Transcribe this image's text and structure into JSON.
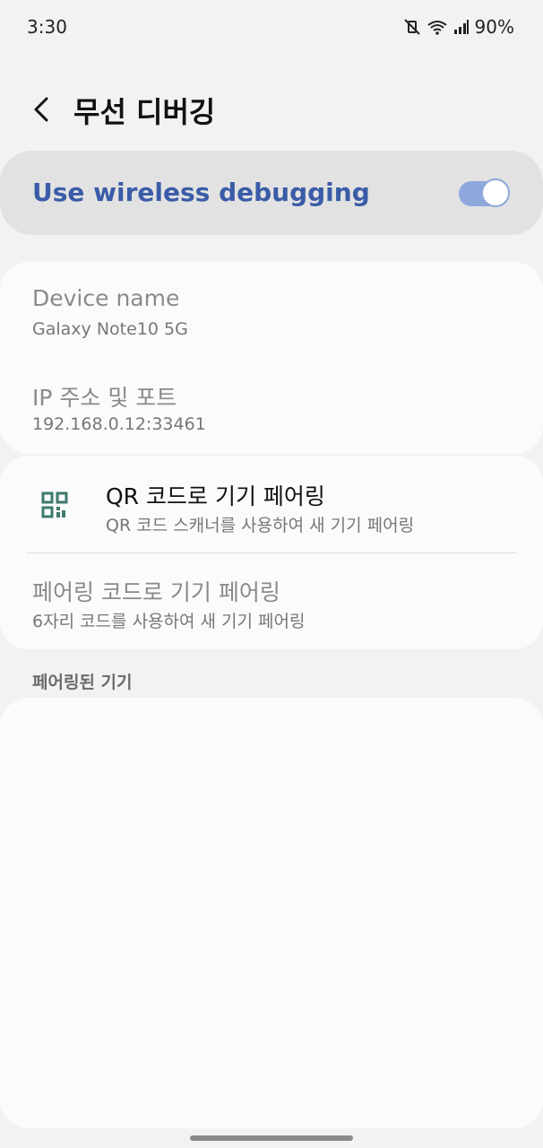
{
  "status_bar": {
    "time": "3:30",
    "battery": "90%",
    "icons": [
      "mute-vibrate-icon",
      "wifi-icon",
      "signal-icon"
    ]
  },
  "header": {
    "title": "무선 디버깅",
    "back_icon": "back-arrow-icon"
  },
  "master_switch": {
    "label": "Use wireless debugging",
    "on": true,
    "accent": "#3a5ca8"
  },
  "info": {
    "device_name_label": "Device name",
    "device_name_value": "Galaxy Note10 5G",
    "ip_label": "IP 주소 및 포트",
    "ip_value": "192.168.0.12:33461"
  },
  "pairing": {
    "qr_title": "QR 코드로 기기 페어링",
    "qr_subtitle": "QR 코드 스캐너를 사용하여 새 기기 페어링",
    "code_title": "페어링 코드로 기기 페어링",
    "code_subtitle": "6자리 코드를 사용하여 새 기기 페어링"
  },
  "paired_devices": {
    "section_label": "페어링된 기기"
  }
}
